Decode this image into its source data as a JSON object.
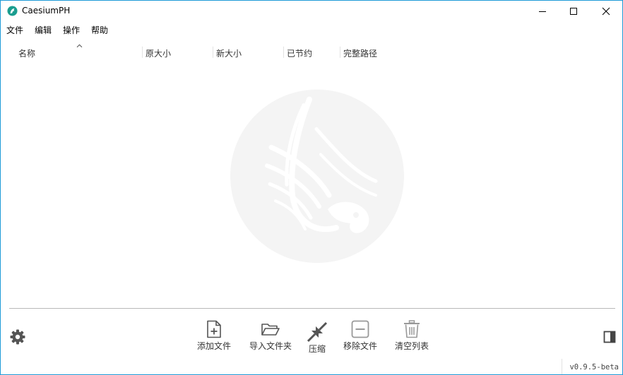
{
  "window": {
    "title": "CaesiumPH"
  },
  "menu": [
    {
      "id": "file",
      "label": "文件"
    },
    {
      "id": "edit",
      "label": "编辑"
    },
    {
      "id": "action",
      "label": "操作"
    },
    {
      "id": "help",
      "label": "帮助"
    }
  ],
  "table": {
    "columns": [
      {
        "id": "name",
        "label": "名称"
      },
      {
        "id": "original-size",
        "label": "原大小"
      },
      {
        "id": "new-size",
        "label": "新大小"
      },
      {
        "id": "saved",
        "label": "已节约"
      },
      {
        "id": "full-path",
        "label": "完整路径"
      }
    ],
    "sort": {
      "column": "name",
      "direction": "ascending"
    },
    "rows": []
  },
  "toolbar": {
    "add_files": "添加文件",
    "import_folder": "导入文件夹",
    "compress": "压缩",
    "remove_files": "移除文件",
    "clear_list": "清空列表"
  },
  "icons": {
    "settings": "gear-icon",
    "side_panel": "side-panel-icon",
    "watermark": "caesium-bird-logo"
  },
  "status": {
    "version": "v0.9.5-beta"
  },
  "colors": {
    "accent": "#1e9bd7",
    "app_icon": "#1a9d8f",
    "icon_gray": "#555555",
    "watermark": "#f4f4f4"
  }
}
